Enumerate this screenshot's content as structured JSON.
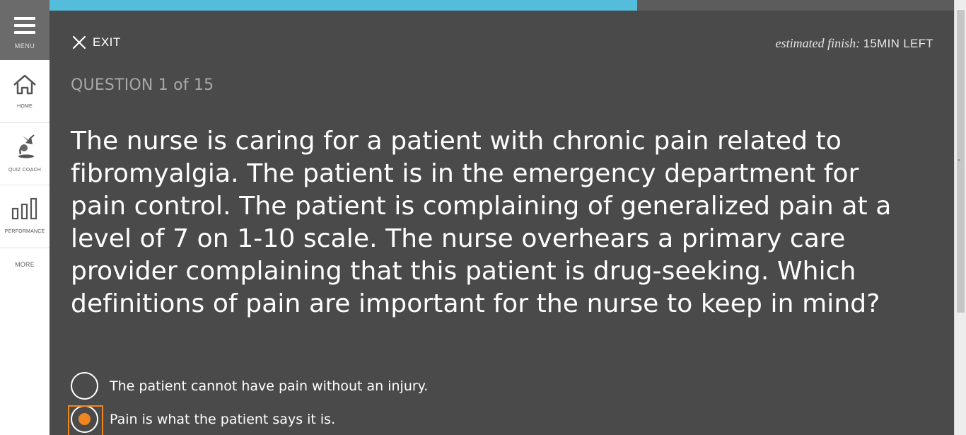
{
  "sidebar": {
    "menu_label": "MENU",
    "items": [
      {
        "label": "HOME",
        "icon": "home-icon"
      },
      {
        "label": "QUIZ COACH",
        "icon": "quiz-coach-icon"
      },
      {
        "label": "PERFORMANCE",
        "icon": "performance-chart-icon"
      },
      {
        "label": "MORE"
      }
    ]
  },
  "progress": {
    "fraction": 0.65,
    "accent": "#54bddc"
  },
  "header": {
    "exit_label": "EXIT",
    "finish_label": "estimated finish:",
    "finish_value": "15MIN LEFT"
  },
  "question": {
    "number_label": "QUESTION 1 of 15",
    "text": "The nurse is caring for a patient with chronic pain related to fibromyalgia. The patient is in the emergency department for pain control. The patient is complaining of generalized pain at a level of 7 on 1-10 scale. The nurse overhears a primary care provider complaining that this patient is drug-seeking. Which definitions of pain are important for the nurse to keep in mind?"
  },
  "options": [
    {
      "text": "The patient cannot have pain without an injury.",
      "selected": false
    },
    {
      "text": "Pain is what the patient says it is.",
      "selected": true
    }
  ],
  "colors": {
    "background": "#4a4a4a",
    "selected": "#f0861e"
  }
}
